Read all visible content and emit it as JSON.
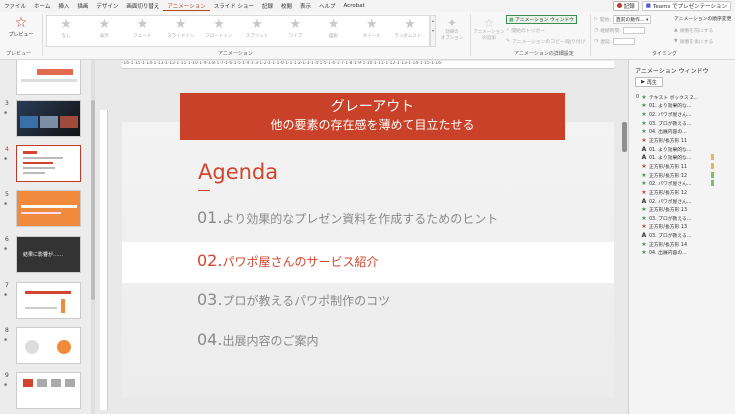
{
  "menu": {
    "items": [
      "ファイル",
      "ホーム",
      "挿入",
      "描画",
      "デザイン",
      "画面切り替え",
      "アニメーション",
      "スライド ショー",
      "記録",
      "校閲",
      "表示",
      "ヘルプ",
      "Acrobat"
    ],
    "active_index": 6,
    "record_label": "記録",
    "teams_label": "Teams でプレゼンテーション"
  },
  "ribbon": {
    "preview_label": "プレビュー",
    "preview_group": "プレビュー",
    "animation_group": "アニメーション",
    "gallery": [
      "なし",
      "表示",
      "フェード",
      "スライドイン",
      "フロートイン",
      "スプリット",
      "ワイプ",
      "図形",
      "ホイール",
      "ランダムスト..."
    ],
    "effect_options": [
      "効果の",
      "オプション"
    ],
    "add_animation": [
      "アニメーション",
      "の追加"
    ],
    "advanced": {
      "animation_window": "アニメーション ウィンドウ",
      "trigger": "開始のトリガー",
      "painter": "アニメーションのコピー/貼り付け",
      "group_label": "アニメーションの詳細設定"
    },
    "timing": {
      "start_label": "開始:",
      "start_value": "直前の動作...",
      "duration_label": "継続時間:",
      "delay_label": "遅延:",
      "reorder_label": "アニメーションの順序変更",
      "earlier": "順番を前にする",
      "later": "順番を後にする",
      "group_label": "タイミング"
    }
  },
  "thumbnails": [
    {
      "num": "3",
      "selected": false
    },
    {
      "num": "4",
      "selected": true
    },
    {
      "num": "5",
      "selected": false
    },
    {
      "num": "6",
      "selected": false
    },
    {
      "num": "7",
      "selected": false
    },
    {
      "num": "8",
      "selected": false
    },
    {
      "num": "9",
      "selected": false
    }
  ],
  "thumb6_text": "結果に影響が……",
  "ruler_text": "·16·1·15·1·14·1·13·1·12·1·11·1·10·1·9·1·8·1·7·1·6·1·5·1·4·1·3·1·2·1·1·1·0·1·1·1·2·1·3·1·4·1·5·1·6·1·7·1·8·1·9·1·10·1·11·1·12·1·13·1·14·1·15·1·16·",
  "slide": {
    "banner_line1": "グレーアウト",
    "banner_line2": "他の要素の存在感を薄めて目立たせる",
    "agenda_title": "Agenda",
    "items": [
      {
        "num": "01.",
        "text": "より効果的なプレゼン資料を作成するためのヒント",
        "highlight": false
      },
      {
        "num": "02.",
        "text": "パワポ屋さんのサービス紹介",
        "highlight": true
      },
      {
        "num": "03.",
        "text": "プロが教えるパワポ制作のコツ",
        "highlight": false
      },
      {
        "num": "04.",
        "text": "出展内容のご案内",
        "highlight": false
      }
    ]
  },
  "pane": {
    "title": "アニメーション ウィンドウ",
    "play_label": "再生",
    "rows": [
      {
        "n": "0",
        "icon": "green",
        "text": "テキスト ボックス 2...",
        "bar": ""
      },
      {
        "n": "",
        "icon": "green",
        "text": "01. より効果的な...",
        "bar": ""
      },
      {
        "n": "",
        "icon": "green",
        "text": "02. パワポ屋さん...",
        "bar": ""
      },
      {
        "n": "",
        "icon": "green",
        "text": "03. プロが教える...",
        "bar": ""
      },
      {
        "n": "",
        "icon": "green",
        "text": "04. 出展内容の...",
        "bar": ""
      },
      {
        "n": "",
        "icon": "red",
        "text": "正方形/長方形 11",
        "bar": ""
      },
      {
        "n": "",
        "icon": "a",
        "text": "01. より効果的な...",
        "bar": ""
      },
      {
        "n": "",
        "icon": "a",
        "text": "01. より効果的な...",
        "bar": "#e8b45c"
      },
      {
        "n": "",
        "icon": "red",
        "text": "正方形/長方形 11",
        "bar": "#e8b45c"
      },
      {
        "n": "",
        "icon": "green",
        "text": "正方形/長方形 12",
        "bar": "#7bbf6a"
      },
      {
        "n": "",
        "icon": "green",
        "text": "02. パワポ屋さん...",
        "bar": "#7bbf6a"
      },
      {
        "n": "",
        "icon": "red",
        "text": "正方形/長方形 12",
        "bar": ""
      },
      {
        "n": "",
        "icon": "a",
        "text": "02. パワポ屋さん...",
        "bar": ""
      },
      {
        "n": "",
        "icon": "green",
        "text": "正方形/長方形 13",
        "bar": ""
      },
      {
        "n": "",
        "icon": "green",
        "text": "03. プロが教える...",
        "bar": ""
      },
      {
        "n": "",
        "icon": "red",
        "text": "正方形/長方形 13",
        "bar": ""
      },
      {
        "n": "",
        "icon": "a",
        "text": "03. プロが教える...",
        "bar": ""
      },
      {
        "n": "",
        "icon": "green",
        "text": "正方形/長方形 14",
        "bar": ""
      },
      {
        "n": "",
        "icon": "green",
        "text": "04. 出展内容の...",
        "bar": ""
      }
    ]
  },
  "colors": {
    "accent": "#c94128",
    "agenda_red": "#d1452e",
    "gray_text": "#8a8a8a"
  }
}
